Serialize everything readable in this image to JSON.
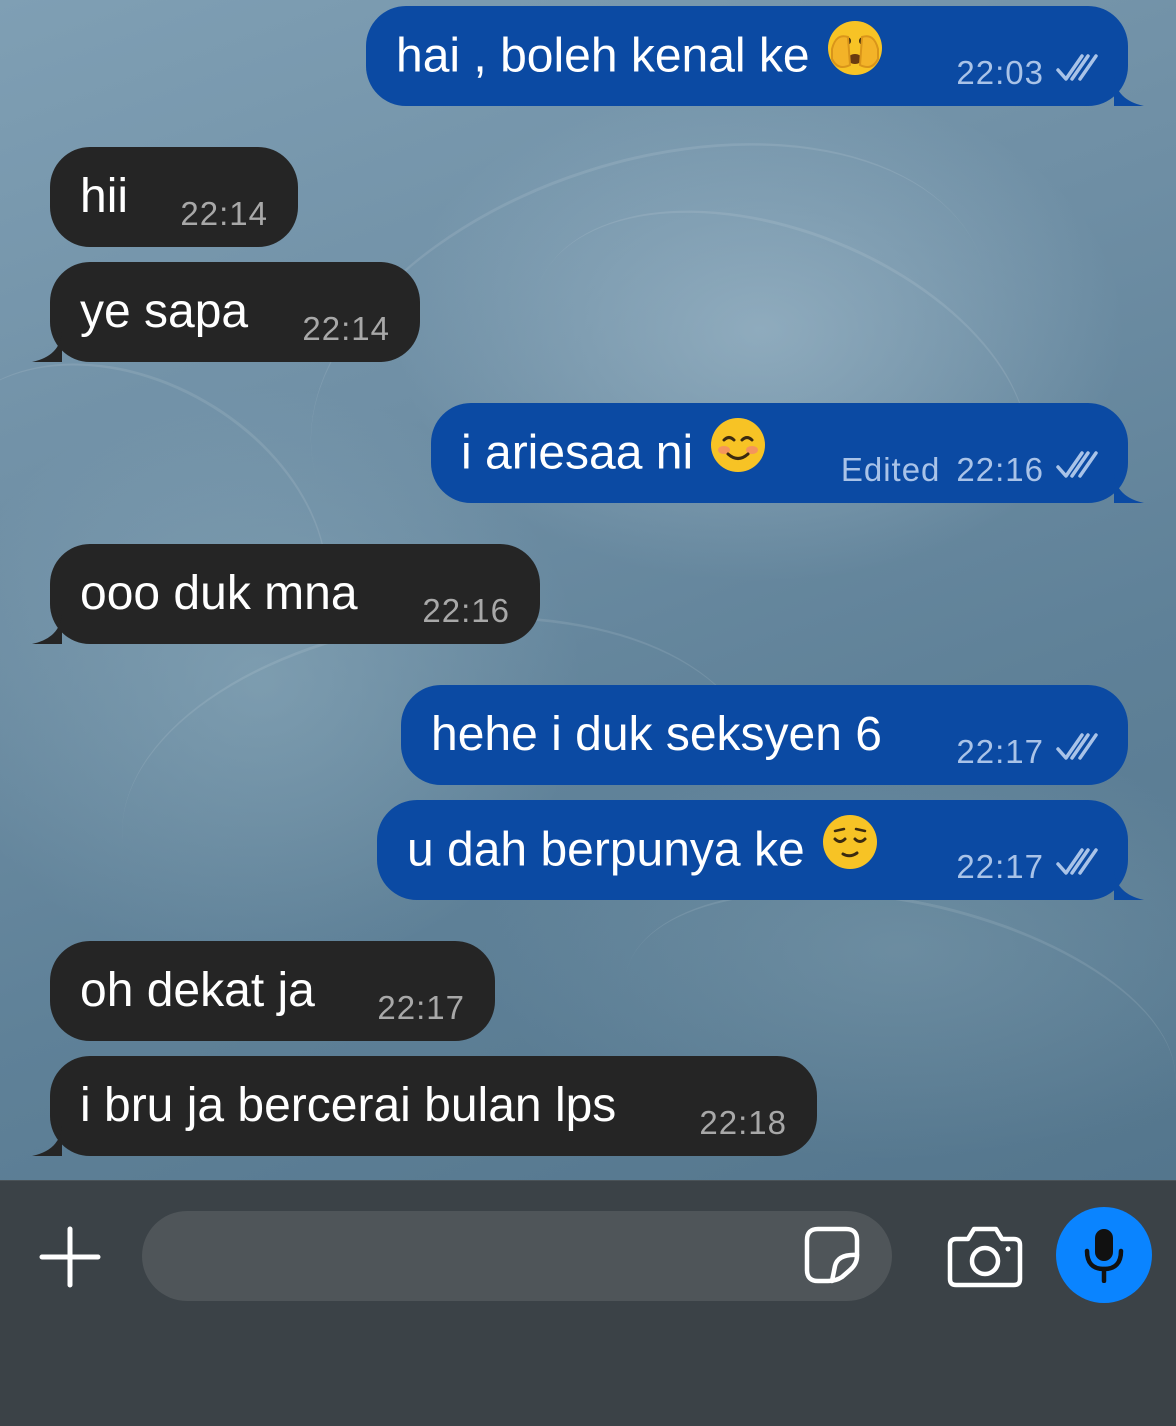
{
  "conversation": {
    "messages": [
      {
        "direction": "outgoing",
        "text": "hai , boleh kenal ke",
        "emoji": "🫣",
        "emoji_name": "face-with-peeking-eye-icon",
        "edited_label": "",
        "time": "22:03",
        "status": "read-double-check"
      },
      {
        "direction": "incoming",
        "text": "hii",
        "time": "22:14"
      },
      {
        "direction": "incoming",
        "text": "ye sapa",
        "time": "22:14"
      },
      {
        "direction": "outgoing",
        "text": "i ariesaa ni",
        "emoji": "☺️",
        "emoji_name": "smiling-face-icon",
        "edited_label": "Edited",
        "time": "22:16",
        "status": "read-double-check"
      },
      {
        "direction": "incoming",
        "text": "ooo duk mna",
        "time": "22:16"
      },
      {
        "direction": "outgoing",
        "text": "hehe i duk seksyen 6",
        "emoji": "",
        "edited_label": "",
        "time": "22:17",
        "status": "read-double-check"
      },
      {
        "direction": "outgoing",
        "text": "u dah berpunya ke",
        "emoji": "😌",
        "emoji_name": "relieved-face-icon",
        "edited_label": "",
        "time": "22:17",
        "status": "read-double-check"
      },
      {
        "direction": "incoming",
        "text": "oh dekat ja",
        "time": "22:17"
      },
      {
        "direction": "incoming",
        "text": "i bru ja bercerai bulan lps",
        "time": "22:18"
      }
    ]
  },
  "composer": {
    "input_value": "",
    "input_placeholder": "",
    "attach_icon": "plus-icon",
    "sticker_icon": "sticker-icon",
    "camera_icon": "camera-icon",
    "mic_icon": "microphone-icon"
  },
  "colors": {
    "outgoing_bubble": "#0b4aa3",
    "incoming_bubble": "#252525",
    "outgoing_meta": "#a9c3e8",
    "incoming_meta": "#a8a8a8",
    "read_checks": "#a9c3e8",
    "mic_button": "#0a84ff",
    "input_bar": "#3b4247",
    "input_field": "#4f5559"
  }
}
